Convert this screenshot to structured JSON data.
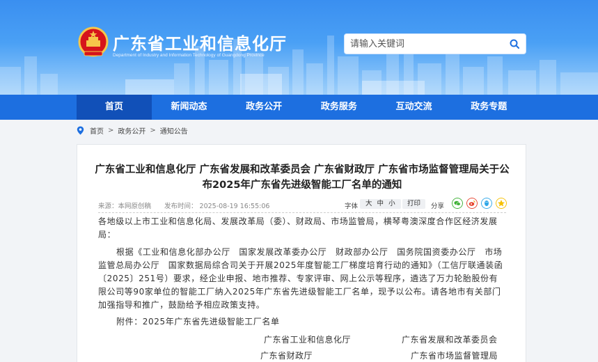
{
  "header": {
    "site_title": "广东省工业和信息化厅",
    "site_subtitle": "Department of Industry and Information Technology of Guangdong Province",
    "search_placeholder": "请输入关键词"
  },
  "nav": {
    "items": [
      {
        "label": "首页"
      },
      {
        "label": "新闻动态"
      },
      {
        "label": "政务公开"
      },
      {
        "label": "政务服务"
      },
      {
        "label": "互动交流"
      },
      {
        "label": "政务专题"
      }
    ]
  },
  "breadcrumb": {
    "items": [
      "首页",
      "政务公开",
      "通知公告"
    ],
    "separator": ">"
  },
  "article": {
    "title": "广东省工业和信息化厅 广东省发展和改革委员会 广东省财政厅 广东省市场监督管理局关于公布2025年广东省先进级智能工厂名单的通知",
    "source": "来源：本网原创稿",
    "date": "发布时间： 2025-08-19 16:55:06",
    "font_label": "字体",
    "font_sizes": [
      "大",
      "中",
      "小"
    ],
    "print_label": "打印",
    "share_label": "分享",
    "salutation": "各地级以上市工业和信息化局、发展改革局（委）、财政局、市场监管局，横琴粤澳深度合作区经济发展局：",
    "paragraph": "根据《工业和信息化部办公厅　国家发展改革委办公厅　财政部办公厅　国务院国资委办公厅　市场监管总局办公厅　国家数据局综合司关于开展2025年度智能工厂梯度培育行动的通知》（工信厅联通装函〔2025〕251号）要求，经企业申报、地市推荐、专家评审、网上公示等程序，遴选了万力轮胎股份有限公司等90家单位的智能工厂纳入2025年广东省先进级智能工厂名单，现予以公布。请各地市有关部门加强指导和推广，鼓励给予相应政策支持。",
    "attachment": "附件：2025年广东省先进级智能工厂名单",
    "signatures": [
      [
        "广东省工业和信息化厅",
        "广东省发展和改革委员会"
      ],
      [
        "广东省财政厅",
        "广东省市场监督管理局"
      ]
    ]
  },
  "colors": {
    "nav_bg": "#1d6fe0",
    "nav_active": "#1150b8",
    "share_wechat": "#3cb034",
    "share_weibo": "#e6432e",
    "share_qq": "#2fa7e8",
    "share_qzone": "#f5c000"
  },
  "icons": [
    "national-emblem-icon",
    "search-icon",
    "location-pin-icon",
    "wechat-icon",
    "weibo-icon",
    "qq-icon",
    "qzone-icon"
  ]
}
